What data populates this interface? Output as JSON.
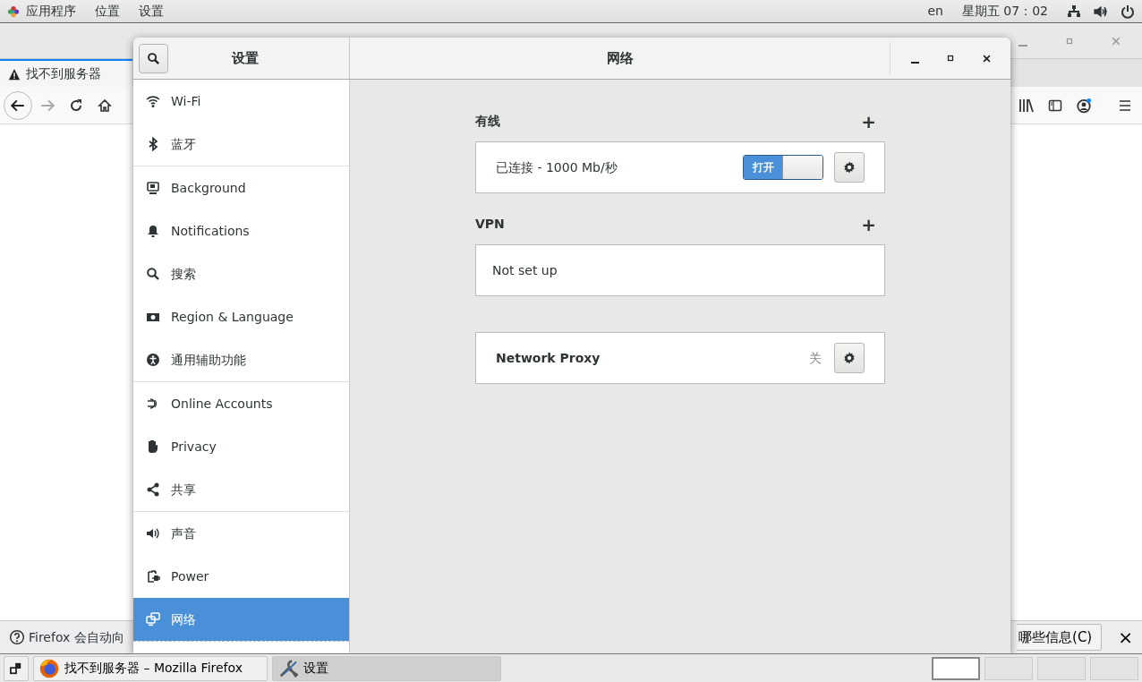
{
  "top_bar": {
    "menus": [
      "应用程序",
      "位置",
      "设置"
    ],
    "language": "en",
    "clock": "星期五 07：02"
  },
  "browser": {
    "tab": {
      "title": "找不到服务器",
      "selected": true
    },
    "notification": {
      "text": "Firefox 会自动向",
      "button": "哪些信息(C)",
      "close": "×"
    }
  },
  "settings": {
    "sidebar_title": "设置",
    "panel_title": "网络",
    "sidebar_groups": [
      [
        {
          "label": "Wi-Fi",
          "selected": false
        },
        {
          "label": "蓝牙",
          "selected": false
        }
      ],
      [
        {
          "label": "Background",
          "selected": false
        },
        {
          "label": "Notifications",
          "selected": false
        },
        {
          "label": "搜索",
          "selected": false
        },
        {
          "label": "Region & Language",
          "selected": false
        },
        {
          "label": "通用辅助功能",
          "selected": false
        }
      ],
      [
        {
          "label": "Online Accounts",
          "selected": false
        },
        {
          "label": "Privacy",
          "selected": false
        },
        {
          "label": "共享",
          "selected": false
        }
      ],
      [
        {
          "label": "声音",
          "selected": false
        },
        {
          "label": "Power",
          "selected": false
        },
        {
          "label": "网络",
          "selected": true
        }
      ]
    ],
    "sections": [
      {
        "title": "有线",
        "add": "+",
        "rows": [
          {
            "kind": "device",
            "label": "已连接 - 1000 Mb/秒",
            "switch": {
              "label": "打开",
              "on": true
            }
          }
        ]
      },
      {
        "title": "VPN",
        "add": "+",
        "rows": [
          {
            "kind": "empty",
            "label": "Not set up"
          }
        ]
      },
      {
        "rows": [
          {
            "kind": "proxy",
            "label": "Network Proxy",
            "status": "关"
          }
        ]
      }
    ]
  },
  "taskbar": {
    "windows": [
      {
        "title": "找不到服务器 – Mozilla Firefox",
        "selected": false
      },
      {
        "title": "设置",
        "selected": true
      }
    ],
    "workspaces": [
      {
        "selected": true
      },
      {
        "selected": false
      },
      {
        "selected": false
      },
      {
        "selected": false
      }
    ]
  }
}
